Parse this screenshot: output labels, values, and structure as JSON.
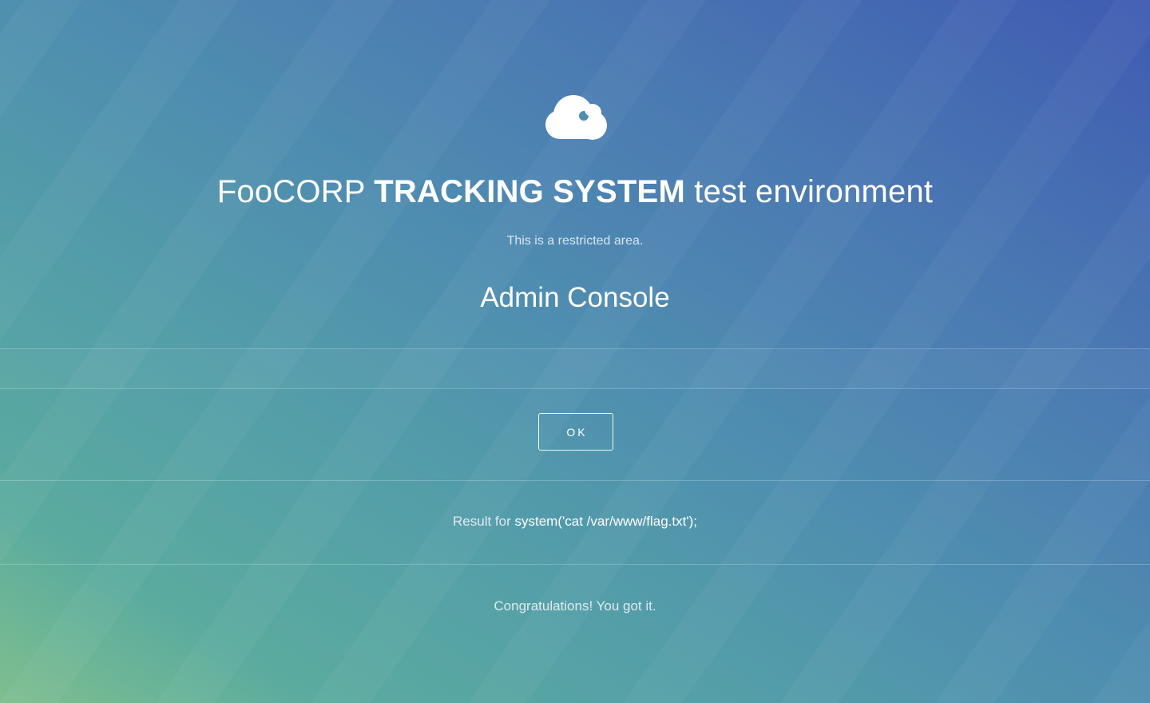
{
  "header": {
    "icon": "cloud-icon",
    "title_prefix": "FooCORP",
    "title_strong": "TRACKING SYSTEM",
    "title_suffix": "test environment",
    "subtitle": "This is a restricted area."
  },
  "console": {
    "title": "Admin Console",
    "ok_label": "OK"
  },
  "result": {
    "label": "Result for",
    "command": "system('cat /var/www/flag.txt');",
    "message": "Congratulations! You got it."
  },
  "colors": {
    "gradient_start": "#7fbf8e",
    "gradient_mid": "#549fa8",
    "gradient_end": "#3f5bb2",
    "text": "#ffffff"
  }
}
